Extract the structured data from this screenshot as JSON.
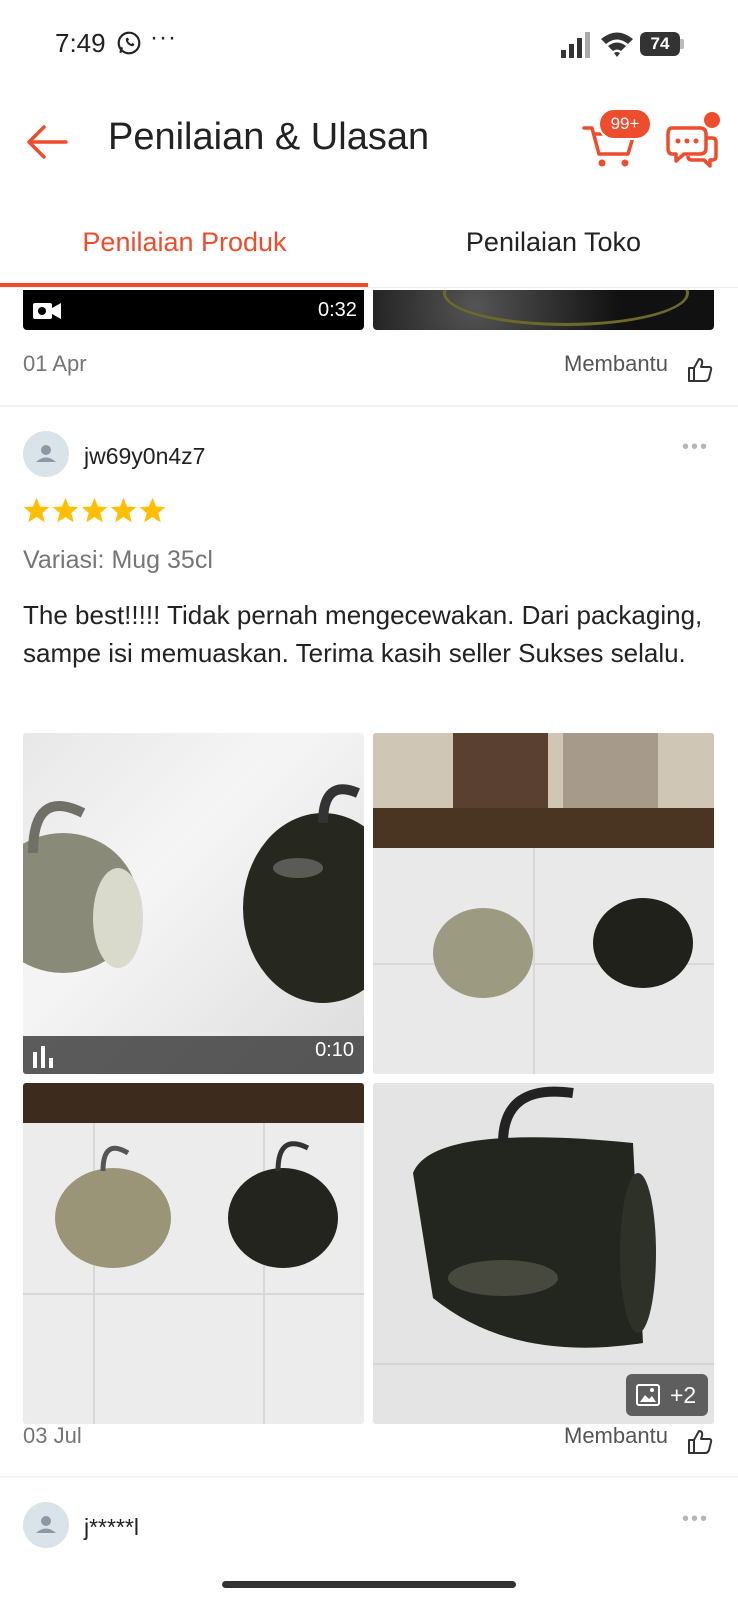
{
  "status_bar": {
    "time": "7:49",
    "overflow": "···",
    "battery": "74"
  },
  "header": {
    "title": "Penilaian & Ulasan",
    "cart_badge": "99+"
  },
  "tabs": [
    {
      "label": "Penilaian Produk",
      "active": true
    },
    {
      "label": "Penilaian Toko",
      "active": false
    }
  ],
  "previous_review": {
    "video_duration": "0:32",
    "date": "01 Apr",
    "helpful_label": "Membantu"
  },
  "review": {
    "username": "jw69y0n4z7",
    "rating": 5,
    "variant": "Variasi: Mug 35cl",
    "text": "The best!!!!! Tidak pernah mengecewakan. Dari packaging, sampe isi memuaskan. Terima kasih seller Sukses selalu.",
    "media": {
      "video_duration": "0:10",
      "more_count": "+2"
    },
    "date": "03 Jul",
    "helpful_label": "Membantu"
  },
  "next_review": {
    "username": "j*****l"
  },
  "colors": {
    "accent": "#ee4d2d",
    "star": "#ffbf00"
  }
}
